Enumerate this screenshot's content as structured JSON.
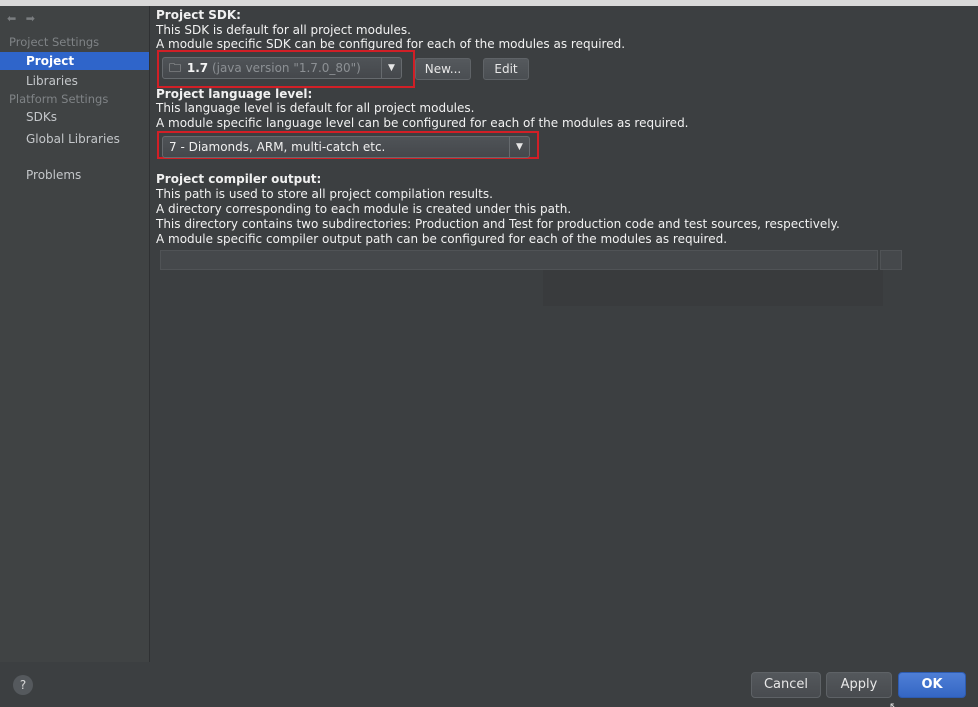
{
  "nav": {
    "back_icon": "arrow-left-icon",
    "forward_icon": "arrow-right-icon"
  },
  "sidebar": {
    "project_settings_header": "Project Settings",
    "platform_settings_header": "Platform Settings",
    "items": [
      {
        "label": "Project",
        "selected": true
      },
      {
        "label": "Libraries"
      },
      {
        "label": "SDKs"
      },
      {
        "label": "Global Libraries"
      },
      {
        "label": "Problems"
      }
    ]
  },
  "main": {
    "sdk": {
      "title": "Project SDK:",
      "line1": "This SDK is default for all project modules.",
      "line2": "A module specific SDK can be configured for each of the modules as required.",
      "selected_version": "1.7",
      "selected_detail": "(java version \"1.7.0_80\")",
      "new_label": "New...",
      "edit_label": "Edit"
    },
    "language": {
      "title": "Project language level:",
      "line1": "This language level is default for all project modules.",
      "line2": "A module specific language level can be configured for each of the modules as required.",
      "selected": "7 - Diamonds, ARM, multi-catch etc."
    },
    "compiler": {
      "title": "Project compiler output:",
      "line1": "This path is used to store all project compilation results.",
      "line2": "A directory corresponding to each module is created under this path.",
      "line3": "This directory contains two subdirectories: Production and Test for production code and test sources, respectively.",
      "line4": "A module specific compiler output path can be configured for each of the modules as required.",
      "path_value": ""
    }
  },
  "footer": {
    "help_label": "?",
    "cancel_label": "Cancel",
    "apply_label": "Apply",
    "ok_label": "OK"
  },
  "colors": {
    "accent": "#2f65ca",
    "highlight_box": "#d11f26",
    "background": "#3c3f41"
  }
}
